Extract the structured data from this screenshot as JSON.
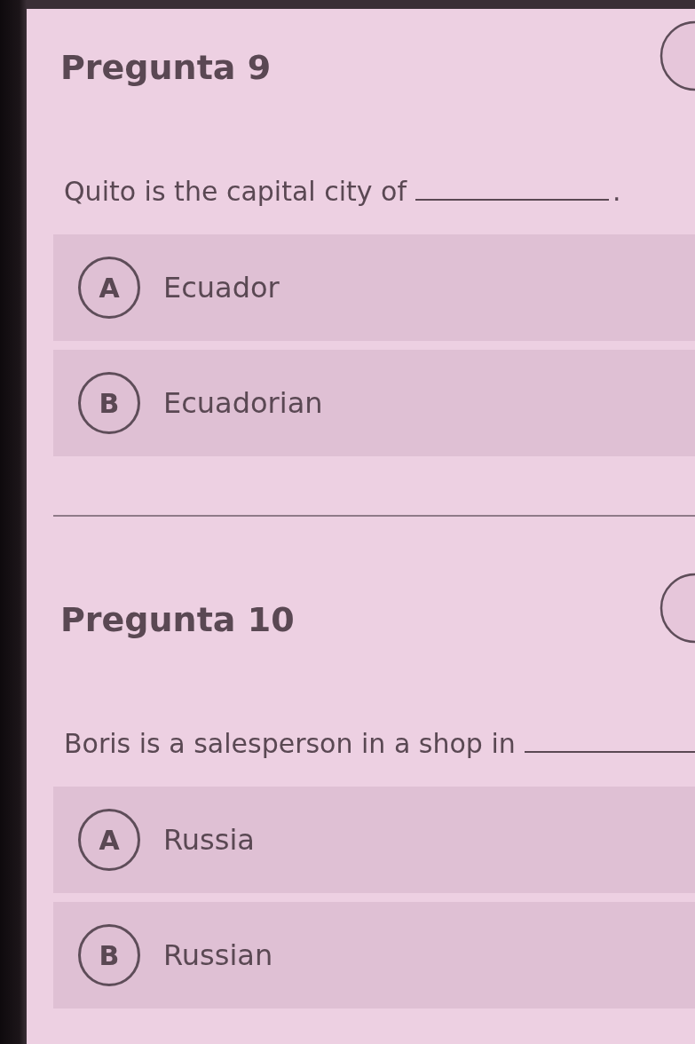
{
  "questions": [
    {
      "title": "Pregunta 9",
      "prompt": "Quito is the capital city of",
      "prompt_end": ".",
      "options": [
        {
          "letter": "A",
          "text": "Ecuador",
          "selected": false
        },
        {
          "letter": "B",
          "text": "Ecuadorian",
          "selected": false
        }
      ]
    },
    {
      "title": "Pregunta 10",
      "prompt": "Boris is a salesperson in a shop in",
      "options": [
        {
          "letter": "A",
          "text": "Russia",
          "selected": false
        },
        {
          "letter": "B",
          "text": "Russian",
          "selected": false
        }
      ]
    }
  ]
}
